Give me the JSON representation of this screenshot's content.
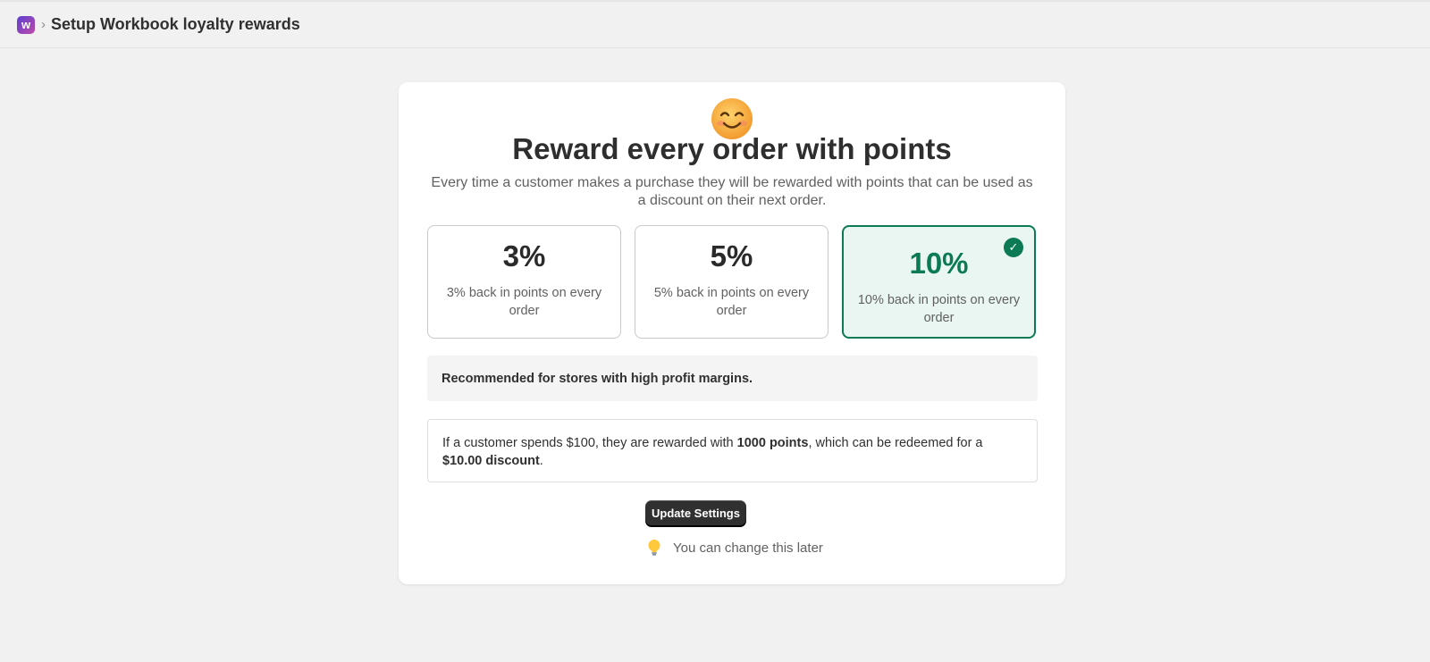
{
  "header": {
    "logo_letter": "w",
    "breadcrumb_separator": "›",
    "title": "Setup Workbook loyalty rewards"
  },
  "main": {
    "emoji_icon": "smiling-face-icon",
    "headline": "Reward every order with points",
    "subtext": "Every time a customer makes a purchase they will be rewarded with points that can be used as a discount on their next order.",
    "options": [
      {
        "percent": "3%",
        "description": "3% back in points on every order",
        "selected": false
      },
      {
        "percent": "5%",
        "description": "5% back in points on every order",
        "selected": false
      },
      {
        "percent": "10%",
        "description": "10% back in points on every order",
        "selected": true
      }
    ],
    "recommendation": "Recommended for stores with high profit margins.",
    "example": {
      "part1": "If a customer spends $100, they are rewarded with ",
      "points": "1000 points",
      "part2": ", which can be redeemed for a ",
      "discount": "$10.00 discount",
      "part3": "."
    },
    "update_button": "Update Settings",
    "hint": "You can change this later"
  },
  "colors": {
    "accent": "#0c7a55",
    "selected_bg": "#e9f6f1",
    "button_bg": "#303030",
    "page_bg": "#f1f1f1"
  }
}
